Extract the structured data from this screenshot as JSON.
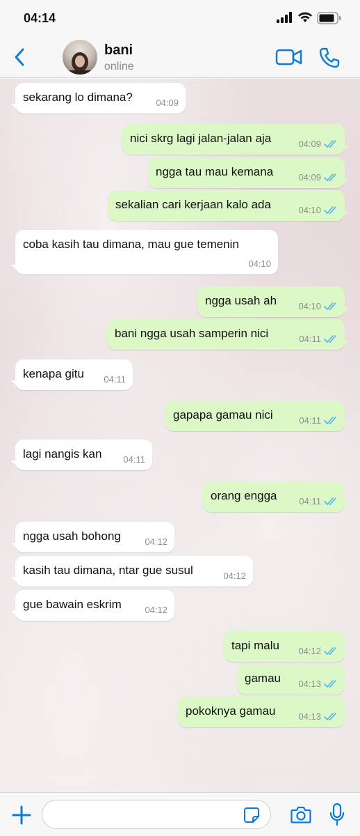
{
  "status_bar": {
    "time": "04:14",
    "icons": [
      "signal-icon",
      "wifi-icon",
      "battery-icon"
    ]
  },
  "header": {
    "contact_name": "bani",
    "contact_status": "online",
    "icons": [
      "back-icon",
      "video-call-icon",
      "voice-call-icon"
    ]
  },
  "colors": {
    "accent": "#0a7bd6",
    "incoming_bubble": "#ffffff",
    "outgoing_bubble": "#dcf8c6",
    "read_ticks": "#4fb4f0"
  },
  "messages": [
    {
      "dir": "in",
      "text": "sekarang lo dimana?",
      "time": "04:09"
    },
    {
      "dir": "out",
      "text": "nici skrg lagi jalan-jalan aja",
      "time": "04:09"
    },
    {
      "dir": "out",
      "text": "ngga tau mau kemana",
      "time": "04:09"
    },
    {
      "dir": "out",
      "text": "sekalian cari kerjaan kalo ada",
      "time": "04:10"
    },
    {
      "dir": "in",
      "text": "coba kasih tau dimana, mau gue temenin",
      "time": "04:10"
    },
    {
      "dir": "out",
      "text": "ngga usah ah",
      "time": "04:10"
    },
    {
      "dir": "out",
      "text": "bani ngga usah samperin nici",
      "time": "04:11"
    },
    {
      "dir": "in",
      "text": "kenapa gitu",
      "time": "04:11"
    },
    {
      "dir": "out",
      "text": "gapapa gamau nici",
      "time": "04:11"
    },
    {
      "dir": "in",
      "text": "lagi nangis kan",
      "time": "04:11"
    },
    {
      "dir": "out",
      "text": "orang engga",
      "time": "04:11"
    },
    {
      "dir": "in",
      "text": "ngga usah bohong",
      "time": "04:12"
    },
    {
      "dir": "in",
      "text": "kasih tau dimana, ntar gue susul",
      "time": "04:12"
    },
    {
      "dir": "in",
      "text": "gue bawain eskrim",
      "time": "04:12"
    },
    {
      "dir": "out",
      "text": "tapi malu",
      "time": "04:12"
    },
    {
      "dir": "out",
      "text": "gamau",
      "time": "04:13"
    },
    {
      "dir": "out",
      "text": "pokoknya gamau",
      "time": "04:13"
    }
  ],
  "composer": {
    "placeholder": "",
    "icons": [
      "plus-icon",
      "sticker-icon",
      "camera-icon",
      "microphone-icon"
    ]
  }
}
